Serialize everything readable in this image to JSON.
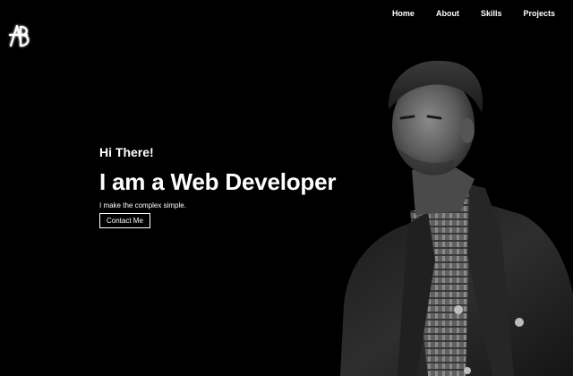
{
  "nav": {
    "items": [
      {
        "label": "Home"
      },
      {
        "label": "About"
      },
      {
        "label": "Skills"
      },
      {
        "label": "Projects"
      }
    ]
  },
  "logo": {
    "icon": "ab-monogram-logo-icon",
    "text": "AB"
  },
  "hero": {
    "greeting": "Hi There!",
    "headline": "I am a Web Developer",
    "tagline": "I make the complex simple.",
    "cta_label": "Contact Me"
  },
  "colors": {
    "background": "#000000",
    "text": "#ffffff"
  }
}
